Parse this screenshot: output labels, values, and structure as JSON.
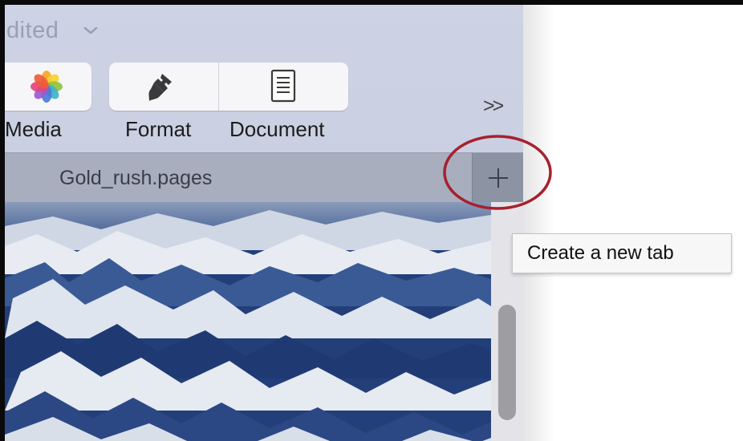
{
  "window": {
    "title_fragment": "dited",
    "title_chevron_icon": "chevron-down-icon"
  },
  "toolbar": {
    "media_label": "Media",
    "format_label": "Format",
    "document_label": "Document",
    "media_icon": "photos-flower-icon",
    "format_icon": "paintbrush-icon",
    "document_icon": "document-icon",
    "overflow_label": ">>"
  },
  "tabbar": {
    "tab_title": "Gold_rush.pages",
    "new_tab_icon": "plus-icon"
  },
  "tooltip": {
    "text": "Create a new tab"
  },
  "colors": {
    "highlight_ring": "#a8202e",
    "toolbar_bg": "#c7cedf",
    "tabbar_bg": "#a8aebd"
  }
}
